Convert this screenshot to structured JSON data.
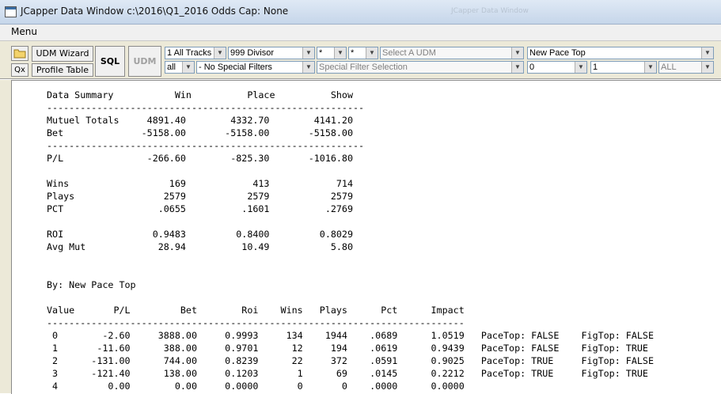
{
  "window": {
    "title": "JCapper Data Window c:\\2016\\Q1_2016 Odds Cap: None",
    "background_title": "JCapper Data Window"
  },
  "menubar": {
    "menu_label": "Menu"
  },
  "toolbar": {
    "udm_wizard": "UDM Wizard",
    "sql": "SQL",
    "udm": "UDM",
    "qx": "Qx",
    "profile_table": "Profile Table",
    "tracks": "1 All Tracks",
    "divisor": "999 Divisor",
    "star1": "*",
    "star2": "*",
    "select_udm": "Select A UDM",
    "pace_factor": "New Pace Top",
    "all_left": "all",
    "special_filters": "- No Special Filters",
    "special_filter_selection": "Special Filter Selection",
    "min_value": "0",
    "max_value": "1",
    "all_right": "ALL"
  },
  "report": {
    "lines": [
      "Data Summary           Win          Place          Show",
      "---------------------------------------------------------",
      "Mutuel Totals     4891.40        4332.70        4141.20",
      "Bet              -5158.00       -5158.00       -5158.00",
      "---------------------------------------------------------",
      "P/L               -266.60        -825.30       -1016.80",
      "",
      "Wins                  169            413            714",
      "Plays                2579           2579           2579",
      "PCT                 .0655          .1601          .2769",
      "",
      "ROI                0.9483         0.8400         0.8029",
      "Avg Mut             28.94          10.49           5.80",
      "",
      "",
      "By: New Pace Top",
      "",
      "Value       P/L         Bet        Roi    Wins   Plays      Pct      Impact",
      "---------------------------------------------------------------------------",
      " 0        -2.60     3888.00     0.9993     134    1944    .0689      1.0519   PaceTop: FALSE    FigTop: FALSE",
      " 1       -11.60      388.00     0.9701      12     194    .0619      0.9439   PaceTop: FALSE    FigTop: TRUE",
      " 2      -131.00      744.00     0.8239      22     372    .0591      0.9025   PaceTop: TRUE     FigTop: FALSE",
      " 3      -121.40      138.00     0.1203       1      69    .0145      0.2212   PaceTop: TRUE     FigTop: TRUE",
      " 4         0.00        0.00     0.0000       0       0    .0000      0.0000"
    ]
  },
  "icons": {
    "folder": "folder-icon",
    "app": "app-window-icon",
    "dropdown": "dropdown-arrow-icon"
  }
}
